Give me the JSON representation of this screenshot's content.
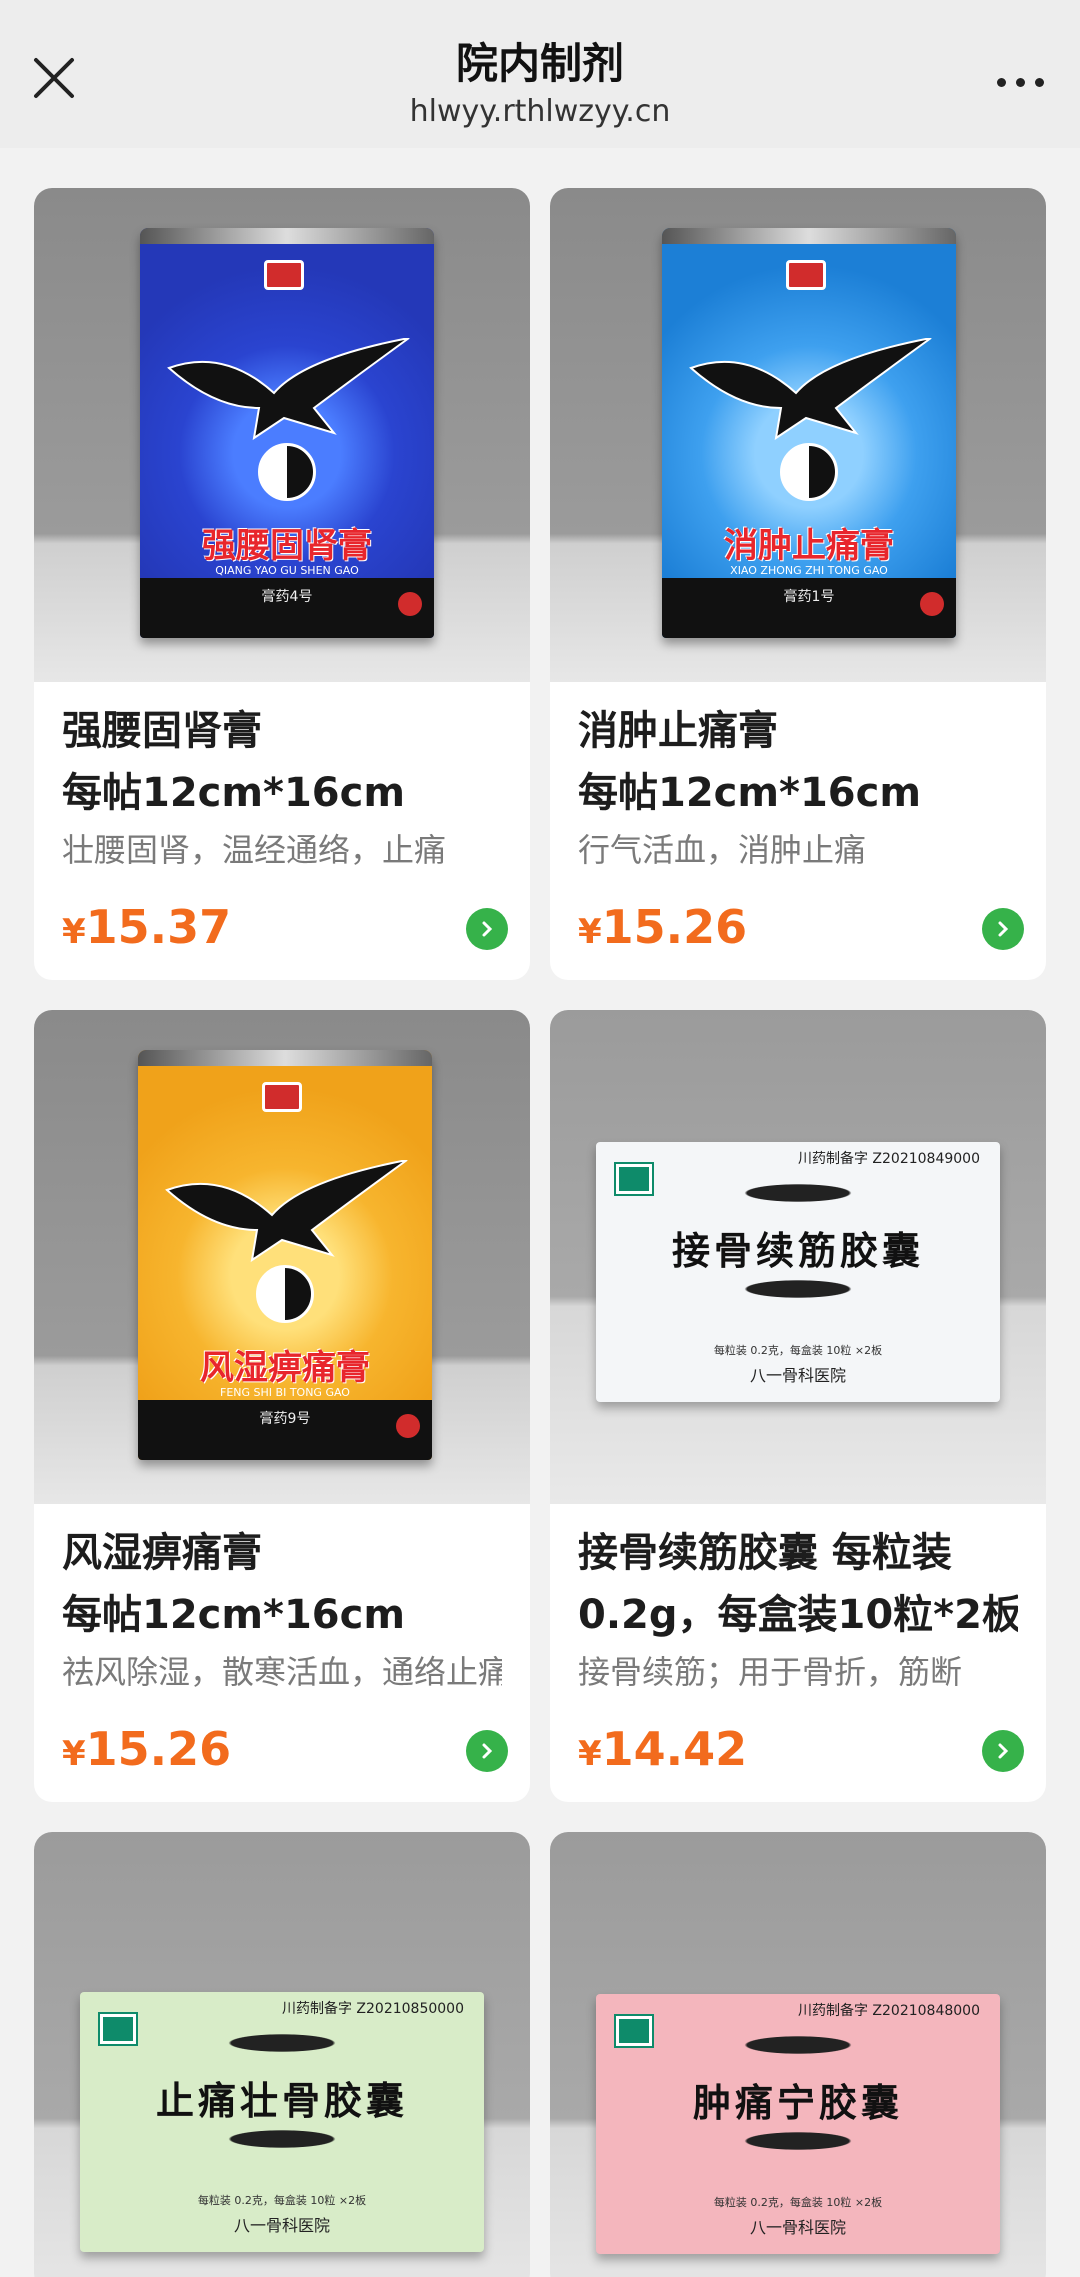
{
  "header": {
    "title": "院内制剂",
    "domain": "hlwyy.rthlwzyy.cn"
  },
  "products": [
    {
      "name": "强腰固肾膏",
      "spec": "每帖12cm*16cm",
      "desc": "壮腰固肾，温经通络，止痛",
      "currency": "¥",
      "price": "15.37",
      "package": {
        "title": "强腰固肾膏",
        "pinyin": "QIANG YAO GU SHEN GAO",
        "tag": "膏药4号",
        "color": "#2438b8"
      }
    },
    {
      "name": "消肿止痛膏",
      "spec": "每帖12cm*16cm",
      "desc": "行气活血，消肿止痛",
      "currency": "¥",
      "price": "15.26",
      "package": {
        "title": "消肿止痛膏",
        "pinyin": "XIAO ZHONG ZHI TONG GAO",
        "tag": "膏药1号",
        "color": "#1c7fd6"
      }
    },
    {
      "name": "风湿痹痛膏",
      "spec": "每帖12cm*16cm",
      "desc": "祛风除湿，散寒活血，通络止痛",
      "currency": "¥",
      "price": "15.26",
      "package": {
        "title": "风湿痹痛膏",
        "pinyin": "FENG SHI BI TONG GAO",
        "tag": "膏药9号",
        "color": "#f0a21a"
      }
    },
    {
      "name": "接骨续筋胶囊 每粒装",
      "spec": "0.2g，每盒装10粒*2板",
      "desc": "接骨续筋；用于骨折，筋断",
      "currency": "¥",
      "price": "14.42",
      "package": {
        "title": "接骨续筋胶囊",
        "license": "川药制备字 Z20210849000",
        "spec": "每粒装 0.2克，每盒装 10粒 ×2板",
        "hospital": "八一骨科医院",
        "color": "#f4f6f8"
      }
    },
    {
      "package": {
        "title": "止痛壮骨胶囊",
        "license": "川药制备字 Z20210850000",
        "spec": "每粒装 0.2克，每盒装 10粒 ×2板",
        "hospital": "八一骨科医院",
        "color": "#d8ecc8"
      }
    },
    {
      "package": {
        "title": "肿痛宁胶囊",
        "license": "川药制备字 Z20210848000",
        "spec": "每粒装 0.2克，每盒装 10粒 ×2板",
        "hospital": "八一骨科医院",
        "color": "#f4b6bd"
      }
    }
  ]
}
